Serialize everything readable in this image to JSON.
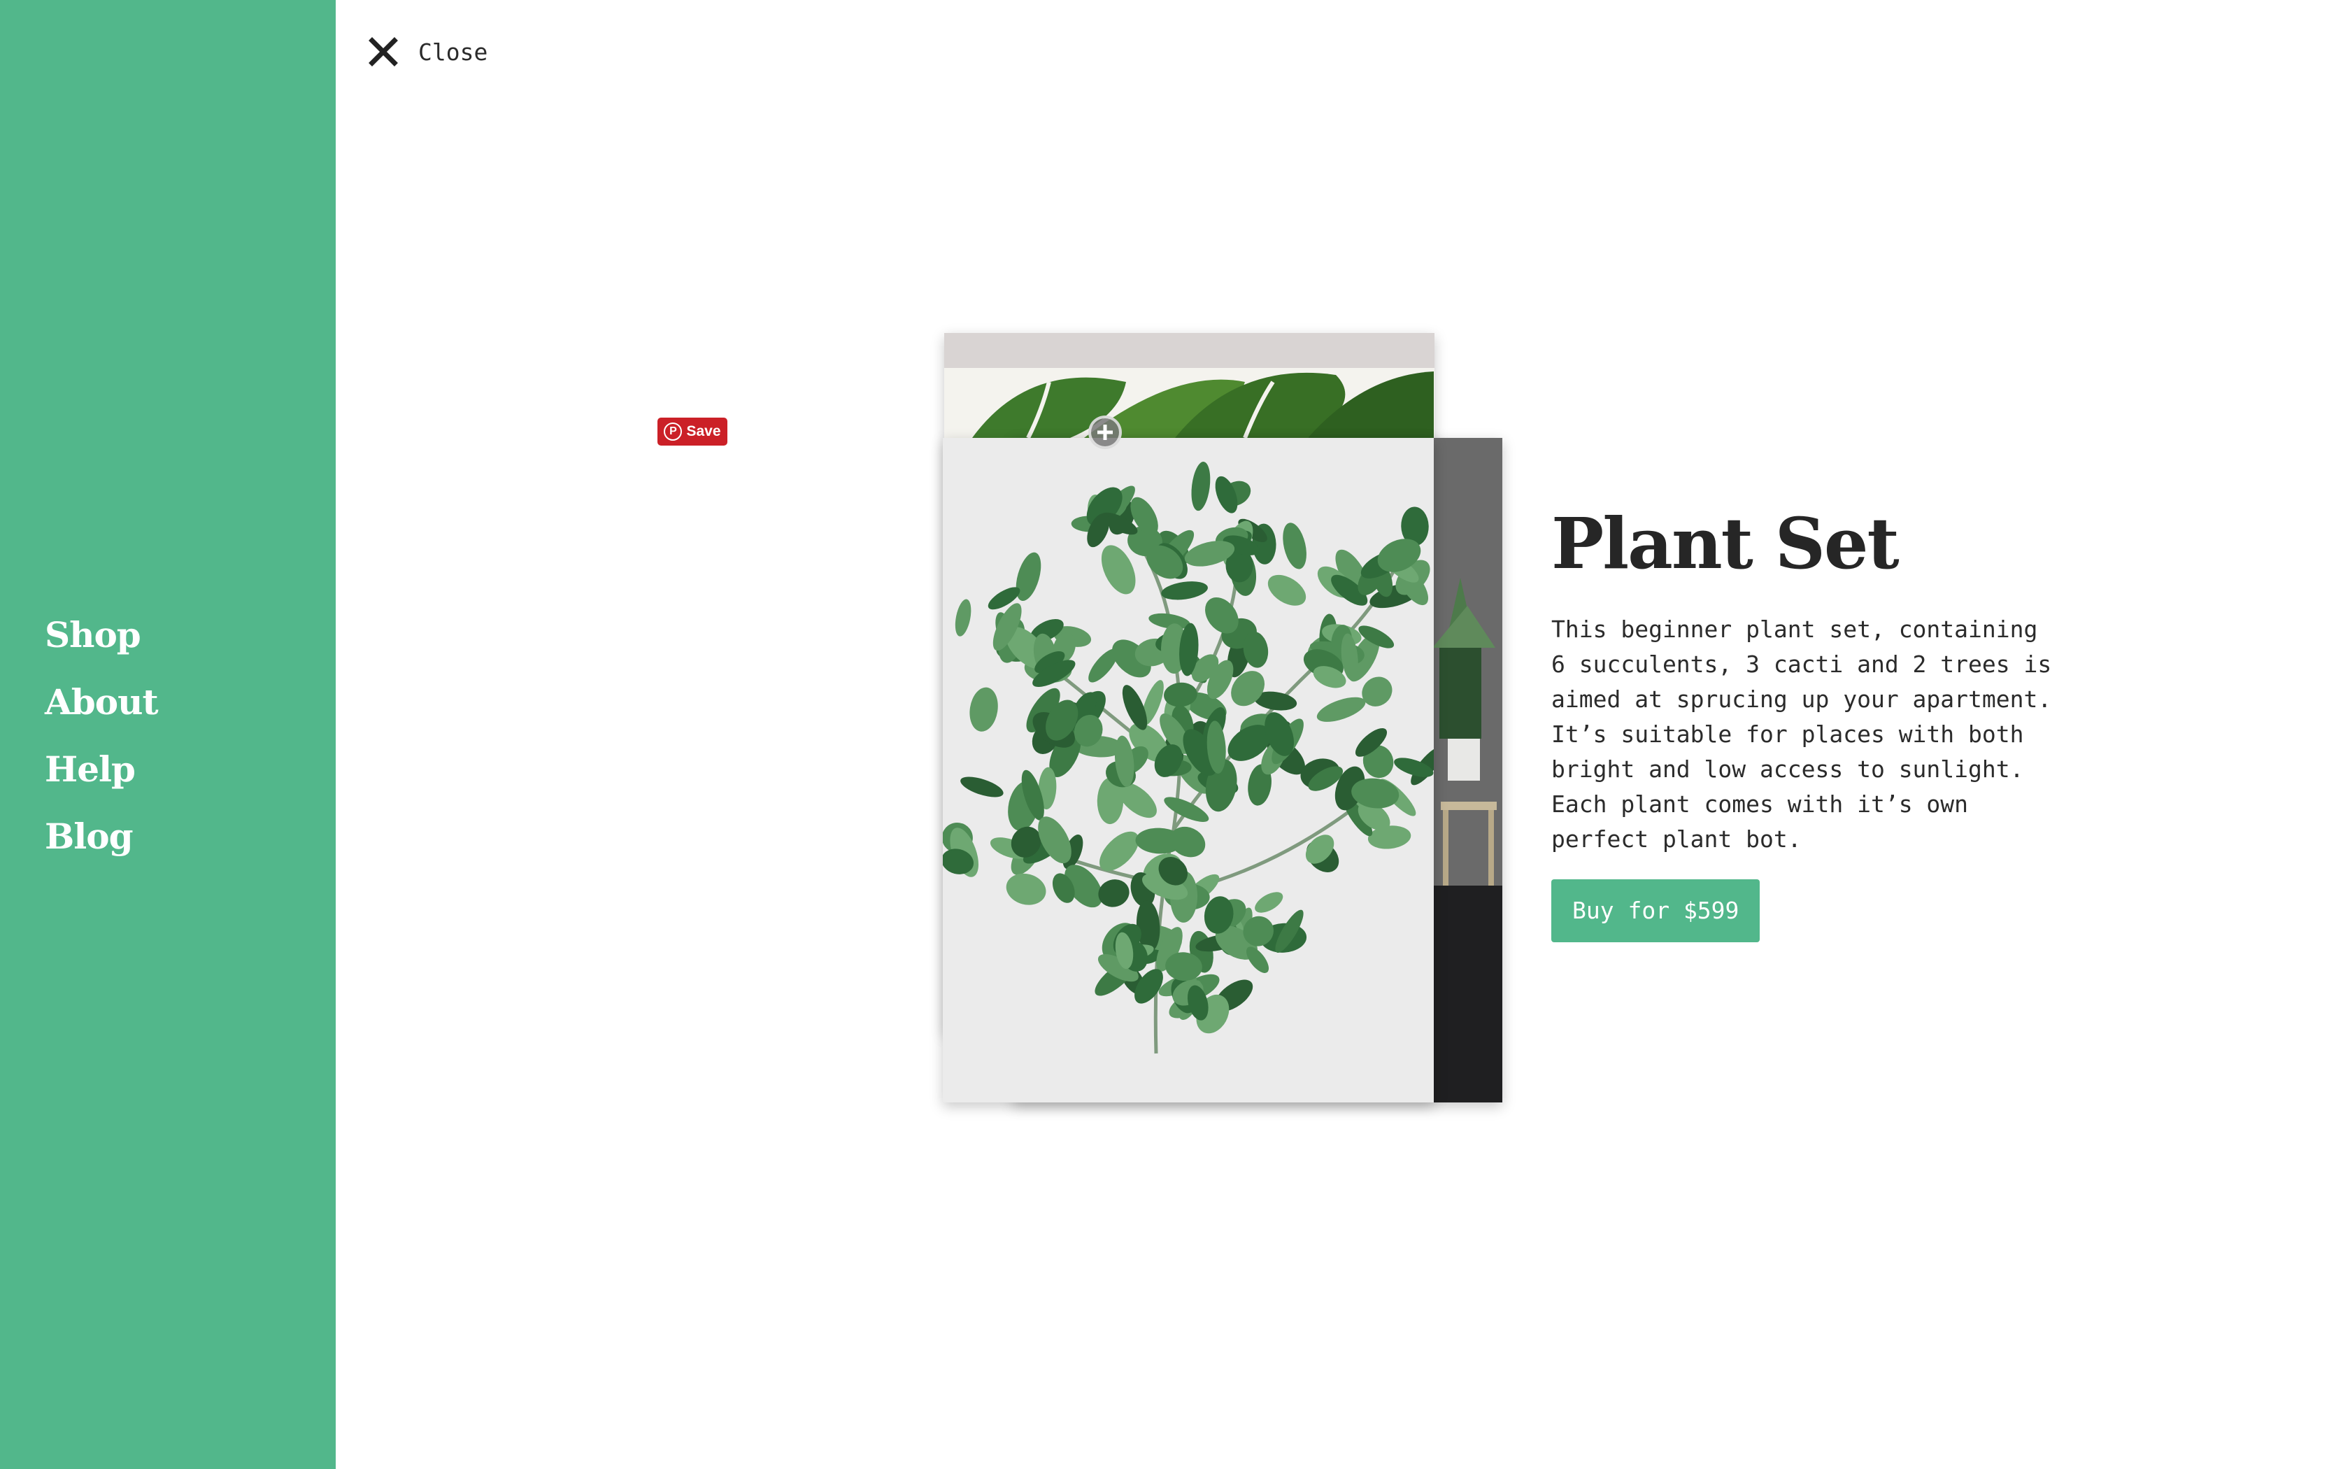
{
  "sidebar": {
    "nav_items": [
      {
        "label": "Shop"
      },
      {
        "label": "About"
      },
      {
        "label": "Help"
      },
      {
        "label": "Blog"
      }
    ]
  },
  "close": {
    "label": "Close",
    "icon": "close-icon"
  },
  "pinterest": {
    "save_label": "Save",
    "color": "#cb2027"
  },
  "product": {
    "title": "Plant Set",
    "description": "This beginner plant set, containing\n6 succulents, 3 cacti and 2 trees is\naimed at sprucing up your apartment.\nIt’s suitable for places with both\nbright and low access to sunlight.\nEach plant comes with it’s own\nperfect plant bot.",
    "buy_label": "Buy for $599"
  },
  "colors": {
    "accent": "#52b78b",
    "text": "#2b2b2b"
  }
}
